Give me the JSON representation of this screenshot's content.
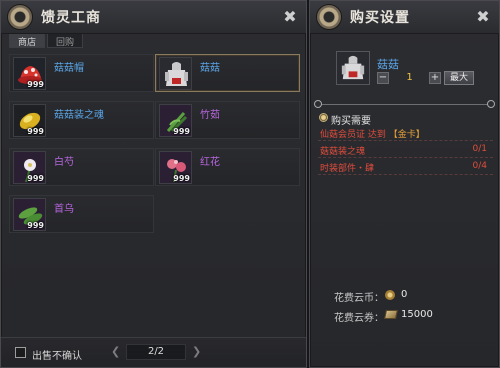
{
  "shop": {
    "title": "馈灵工商",
    "tabs": [
      {
        "label": "商店",
        "active": true
      },
      {
        "label": "回购",
        "active": false
      }
    ],
    "items": [
      {
        "name": "菇菇帽",
        "qty": "999",
        "color": "#5aa6e8",
        "icon": "red-hat-icon"
      },
      {
        "name": "菇菇",
        "qty": "999",
        "color": "#5aa6e8",
        "icon": "mushroom-costume-icon",
        "selected": true
      },
      {
        "name": "菇菇装之魂",
        "qty": "999",
        "color": "#5aa6e8",
        "icon": "soul-gem-icon"
      },
      {
        "name": "竹茹",
        "qty": "999",
        "color": "#b866e0",
        "icon": "bamboo-herb-icon"
      },
      {
        "name": "白芍",
        "qty": "999",
        "color": "#b866e0",
        "icon": "white-flower-icon"
      },
      {
        "name": "红花",
        "qty": "999",
        "color": "#b866e0",
        "icon": "red-flower-icon"
      },
      {
        "name": "首乌",
        "qty": "999",
        "color": "#b866e0",
        "icon": "leaf-herb-icon"
      }
    ],
    "footer": {
      "no_confirm_label": "出售不确认",
      "page": "2/2"
    }
  },
  "buy": {
    "title": "购买设置",
    "selected_name": "菇菇",
    "minus_label": "−",
    "quantity": "1",
    "plus_label": "+",
    "max_label": "最大",
    "requirements_title": "购买需要",
    "requirements": [
      {
        "text_prefix": "仙菇会员证 达到 ",
        "text_highlight": "【金卡】",
        "count": ""
      },
      {
        "text_prefix": "菇菇装之魂",
        "text_highlight": "",
        "count": "0/1"
      },
      {
        "text_prefix": "时装部件・肆",
        "text_highlight": "",
        "count": "0/4"
      }
    ],
    "cost_coin_label": "花费云币：",
    "cost_coin_value": "0",
    "cost_ticket_label": "花费云券：",
    "cost_ticket_value": "15000"
  },
  "colors": {
    "name_blue": "#5aa6e8",
    "name_purple": "#b866e0",
    "requirement_red": "#e04c3c",
    "quantity_gold": "#f0c048"
  }
}
